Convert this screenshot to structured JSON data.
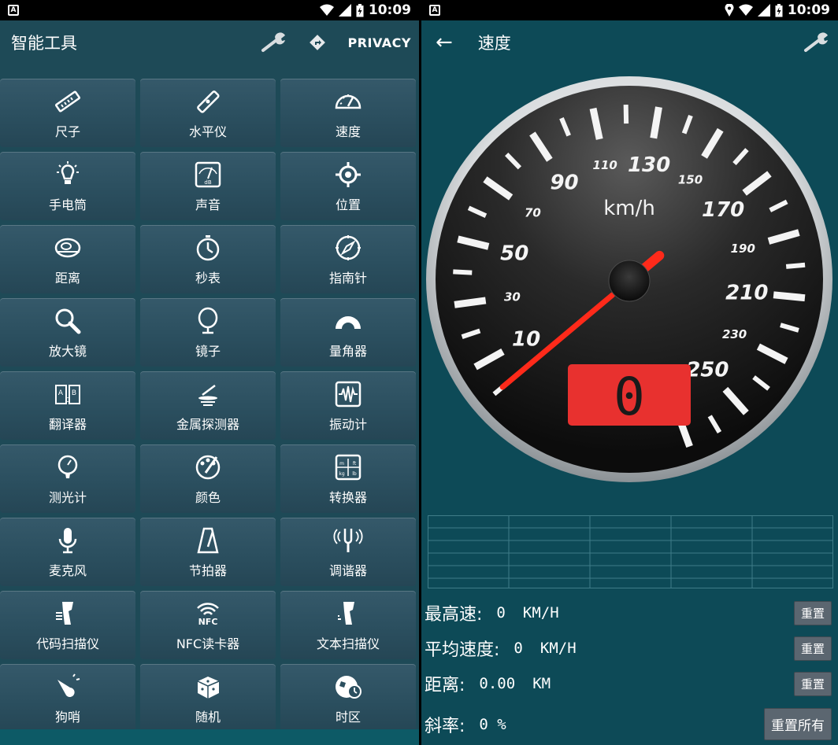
{
  "status_bar": {
    "time": "10:09"
  },
  "left": {
    "title": "智能工具",
    "privacy_label": "PRIVACY",
    "tools": [
      {
        "label": "尺子",
        "icon": "ruler-icon"
      },
      {
        "label": "水平仪",
        "icon": "level-icon"
      },
      {
        "label": "速度",
        "icon": "speedometer-icon"
      },
      {
        "label": "手电筒",
        "icon": "flashlight-icon"
      },
      {
        "label": "声音",
        "icon": "sound-meter-icon"
      },
      {
        "label": "位置",
        "icon": "location-icon"
      },
      {
        "label": "距离",
        "icon": "tape-measure-icon"
      },
      {
        "label": "秒表",
        "icon": "stopwatch-icon"
      },
      {
        "label": "指南针",
        "icon": "compass-icon"
      },
      {
        "label": "放大镜",
        "icon": "magnifier-icon"
      },
      {
        "label": "镜子",
        "icon": "mirror-icon"
      },
      {
        "label": "量角器",
        "icon": "protractor-icon"
      },
      {
        "label": "翻译器",
        "icon": "translator-icon"
      },
      {
        "label": "金属探测器",
        "icon": "metal-detector-icon"
      },
      {
        "label": "振动计",
        "icon": "vibration-meter-icon"
      },
      {
        "label": "测光计",
        "icon": "light-meter-icon"
      },
      {
        "label": "颜色",
        "icon": "color-palette-icon"
      },
      {
        "label": "转换器",
        "icon": "unit-converter-icon"
      },
      {
        "label": "麦克风",
        "icon": "microphone-icon"
      },
      {
        "label": "节拍器",
        "icon": "metronome-icon"
      },
      {
        "label": "调谐器",
        "icon": "tuning-fork-icon"
      },
      {
        "label": "代码扫描仪",
        "icon": "barcode-scanner-icon"
      },
      {
        "label": "NFC读卡器",
        "icon": "nfc-icon"
      },
      {
        "label": "文本扫描仪",
        "icon": "text-scanner-icon"
      },
      {
        "label": "狗哨",
        "icon": "dog-whistle-icon"
      },
      {
        "label": "随机",
        "icon": "dice-icon"
      },
      {
        "label": "时区",
        "icon": "world-clock-icon"
      }
    ]
  },
  "right": {
    "title": "速度",
    "gauge": {
      "unit": "km/h",
      "major_labels": [
        "10",
        "50",
        "90",
        "130",
        "170",
        "210",
        "250"
      ],
      "minor_labels": [
        "30",
        "70",
        "110",
        "150",
        "190",
        "230"
      ],
      "min": 0,
      "max": 270,
      "current_value": 0,
      "readout": "0",
      "colors": {
        "readout_bg": "#e8312f",
        "needle": "#ff2a1a"
      }
    },
    "stats": {
      "max_speed": {
        "label": "最高速:",
        "value": "0",
        "unit": "KM/H",
        "reset": "重置"
      },
      "avg_speed": {
        "label": "平均速度:",
        "value": "0",
        "unit": "KM/H",
        "reset": "重置"
      },
      "distance": {
        "label": "距离:",
        "value": "0.00",
        "unit": "KM",
        "reset": "重置"
      },
      "slope": {
        "label": "斜率:",
        "value": "0 %"
      }
    },
    "reset_all": "重置所有"
  }
}
